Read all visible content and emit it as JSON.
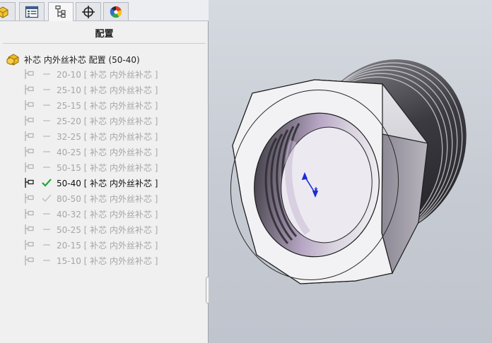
{
  "panel": {
    "tabs": [
      {
        "name": "feature-manager",
        "icon": "part-icon"
      },
      {
        "name": "property-manager",
        "icon": "property-list-icon"
      },
      {
        "name": "configuration-manager",
        "icon": "configuration-icon",
        "active": true
      },
      {
        "name": "dimxpert-manager",
        "icon": "crosshair-icon"
      },
      {
        "name": "display-manager",
        "icon": "appearance-icon"
      }
    ],
    "title": "配置",
    "root": {
      "label": "补芯 内外丝补芯 配置  (50-40)",
      "icon": "part-icon"
    },
    "configurations": [
      {
        "label": "20-10 [ 补芯 内外丝补芯 ]",
        "state": "inactive"
      },
      {
        "label": "25-10 [ 补芯 内外丝补芯 ]",
        "state": "inactive"
      },
      {
        "label": "25-15 [ 补芯 内外丝补芯 ]",
        "state": "inactive"
      },
      {
        "label": "25-20 [ 补芯 内外丝补芯 ]",
        "state": "inactive"
      },
      {
        "label": "32-25 [ 补芯 内外丝补芯 ]",
        "state": "inactive"
      },
      {
        "label": "40-25 [ 补芯 内外丝补芯 ]",
        "state": "inactive"
      },
      {
        "label": "50-15 [ 补芯 内外丝补芯 ]",
        "state": "inactive"
      },
      {
        "label": "50-40 [ 补芯 内外丝补芯 ]",
        "state": "active"
      },
      {
        "label": "80-50 [ 补芯 内外丝补芯 ]",
        "state": "checked-inactive"
      },
      {
        "label": "40-32 [ 补芯 内外丝补芯 ]",
        "state": "inactive"
      },
      {
        "label": "50-25 [ 补芯 内外丝补芯 ]",
        "state": "inactive"
      },
      {
        "label": "20-15 [ 补芯 内外丝补芯 ]",
        "state": "inactive"
      },
      {
        "label": "15-10 [ 补芯 内外丝补芯 ]",
        "state": "inactive"
      }
    ]
  },
  "viewport": {
    "model": "hex-bushing-3d-model",
    "colors": {
      "background": "#c9ced6",
      "hex_face": "#f2f2f4",
      "thread_dark": "#3c3c42",
      "bore_tint": "#a58fb8",
      "triad_blue": "#1d2bd6"
    }
  },
  "colors": {
    "active_check": "#27a33a",
    "inactive_text": "#a6a6a6",
    "part_icon": "#f0b21d"
  }
}
